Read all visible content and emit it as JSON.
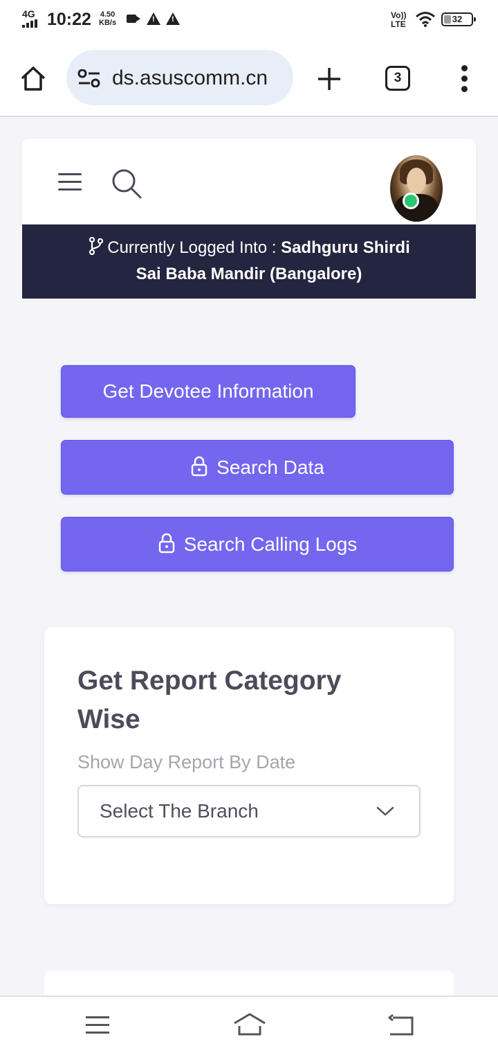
{
  "status_bar": {
    "network": "4G",
    "time": "10:22",
    "speed_value": "4.50",
    "speed_unit": "KB/s",
    "volte_top": "Vo))",
    "volte_bottom": "LTE",
    "battery": "32"
  },
  "browser": {
    "url": "ds.asuscomm.cn",
    "tab_count": "3",
    "icons": [
      "home-icon",
      "site-settings-icon",
      "new-tab-icon",
      "tabs-icon",
      "more-vert-icon"
    ]
  },
  "header": {
    "icons": [
      "menu-icon",
      "search-icon",
      "avatar",
      "online-status-dot"
    ],
    "status_color": "#29c76f"
  },
  "login_banner": {
    "prefix": "Currently Logged Into : ",
    "org_line1": "Sadhguru Shirdi",
    "org_line2": "Sai Baba Mandir (Bangalore)"
  },
  "actions": {
    "get_devotee": "Get Devotee Information",
    "search_data": "Search Data",
    "search_logs": "Search Calling Logs",
    "accent_color": "#7366ef"
  },
  "report": {
    "title": "Get Report Category Wise",
    "subtitle": "Show Day Report By Date",
    "branch_select": "Select The Branch"
  },
  "nav": {
    "icons": [
      "recents-icon",
      "home-icon",
      "back-icon"
    ]
  }
}
